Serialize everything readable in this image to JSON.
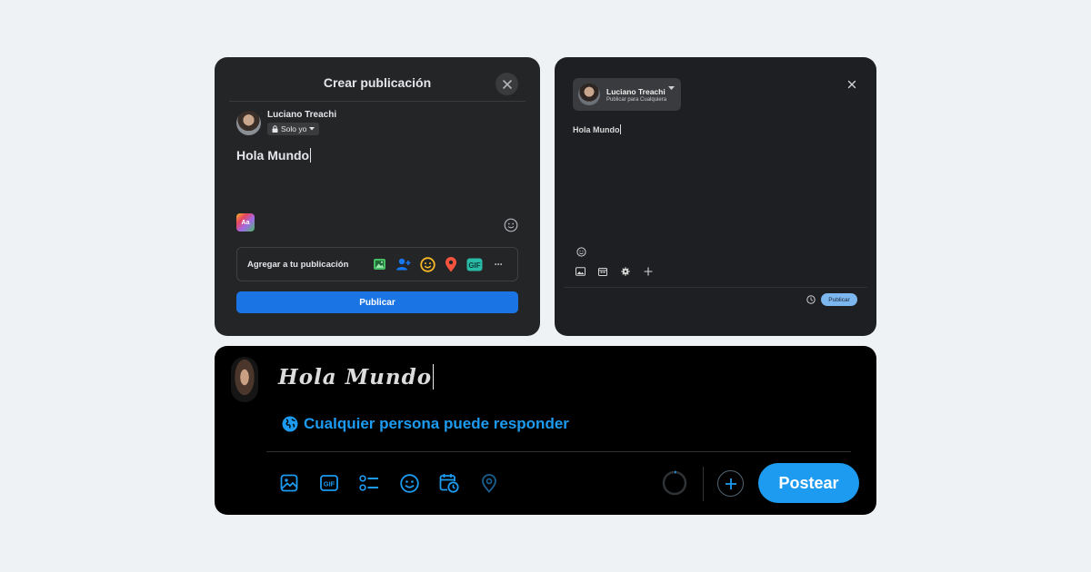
{
  "facebook": {
    "title": "Crear publicación",
    "user_name": "Luciano Treachi",
    "privacy": "Solo yo",
    "post_text": "Hola Mundo",
    "text_style_label": "Aa",
    "add_to_post": "Agregar a tu publicación",
    "add_icons": [
      "photo-icon",
      "tag-people-icon",
      "feeling-icon",
      "location-icon",
      "gif-icon",
      "more-icon"
    ],
    "gif_label": "GIF",
    "more_label": "···",
    "publish": "Publicar",
    "colors": {
      "background": "#242526",
      "publish": "#1b74e4"
    }
  },
  "threads": {
    "user_name": "Luciano Treachi",
    "audience": "Publicar para Cualquiera",
    "post_text": "Hola Mundo",
    "tools": [
      "image-icon",
      "calendar-icon",
      "settings-icon",
      "plus-icon"
    ],
    "publish": "Publicar",
    "colors": {
      "background": "#1e1f22",
      "publish": "#7db7f0"
    }
  },
  "twitter": {
    "post_text": "Hola Mundo",
    "reply_setting": "Cualquier persona puede responder",
    "tools": [
      "image-icon",
      "gif-icon",
      "poll-icon",
      "emoji-icon",
      "schedule-icon",
      "location-icon"
    ],
    "gif_label": "GIF",
    "post_button": "Postear",
    "colors": {
      "background": "#000000",
      "accent": "#1d9bf0"
    }
  }
}
